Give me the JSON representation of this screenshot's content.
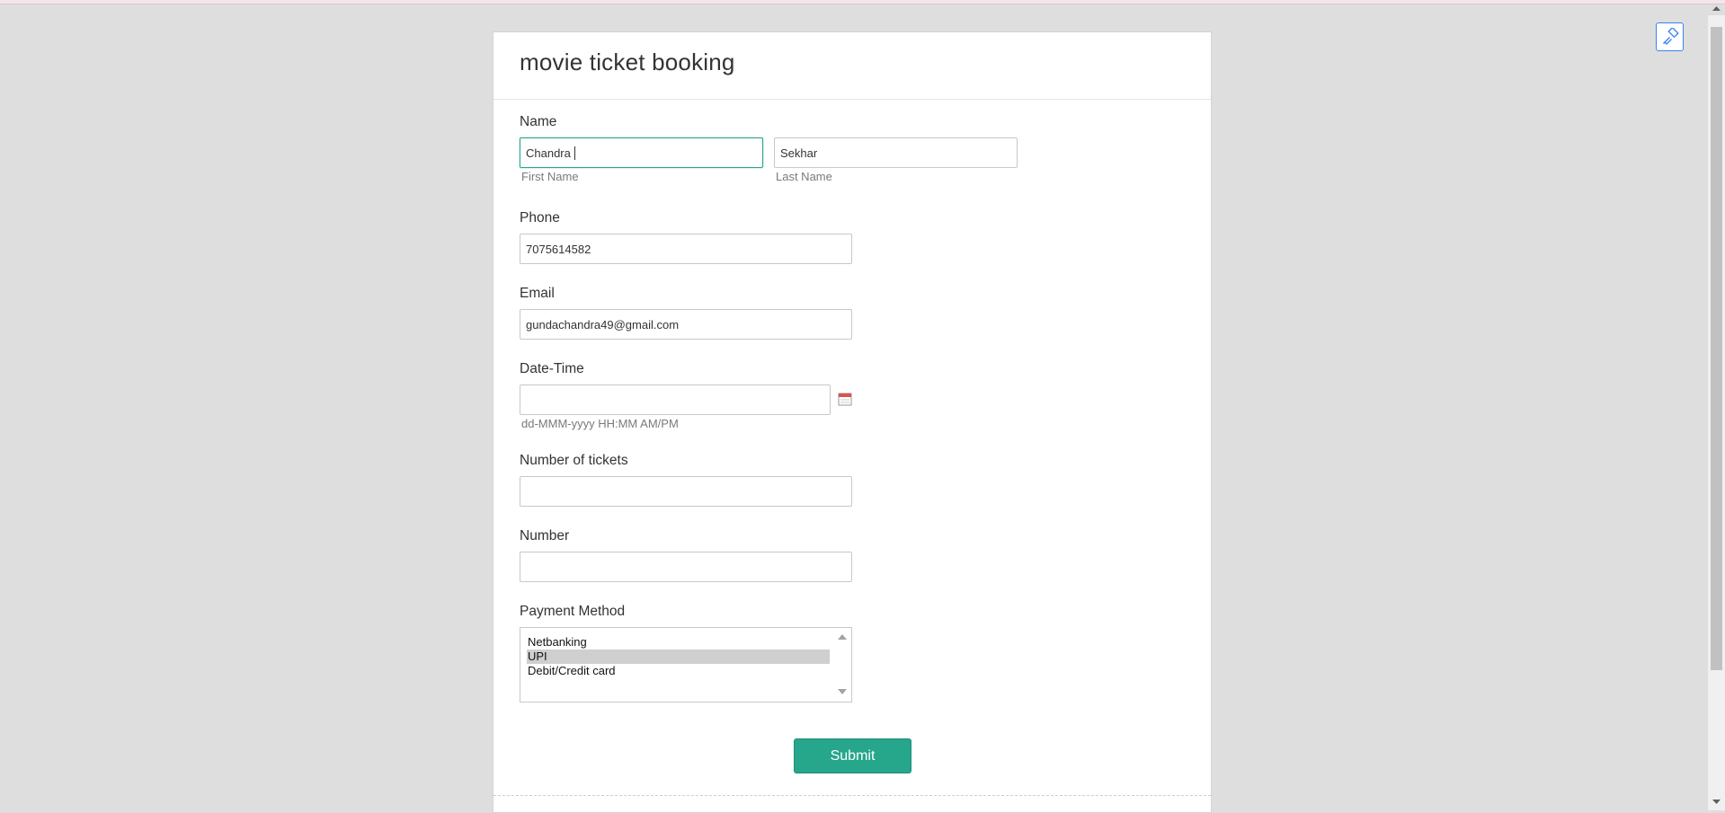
{
  "form": {
    "title": "movie ticket booking",
    "name": {
      "label": "Name",
      "first_value": "Chandra ",
      "first_hint": "First Name",
      "last_value": "Sekhar",
      "last_hint": "Last Name"
    },
    "phone": {
      "label": "Phone",
      "value": "7075614582"
    },
    "email": {
      "label": "Email",
      "value": "gundachandra49@gmail.com"
    },
    "datetime": {
      "label": "Date-Time",
      "value": "",
      "hint": "dd-MMM-yyyy HH:MM AM/PM",
      "icon": "calendar-icon"
    },
    "tickets": {
      "label": "Number of tickets",
      "value": ""
    },
    "number": {
      "label": "Number",
      "value": ""
    },
    "payment": {
      "label": "Payment Method",
      "options": [
        "Netbanking",
        "UPI",
        "Debit/Credit card"
      ],
      "selected": "UPI"
    },
    "submit_label": "Submit"
  },
  "colors": {
    "accent": "#26a68b",
    "page_background": "#dedede",
    "floating_button_border": "#3b82f6"
  },
  "floating_tool": {
    "icon": "paint-roller-icon"
  }
}
